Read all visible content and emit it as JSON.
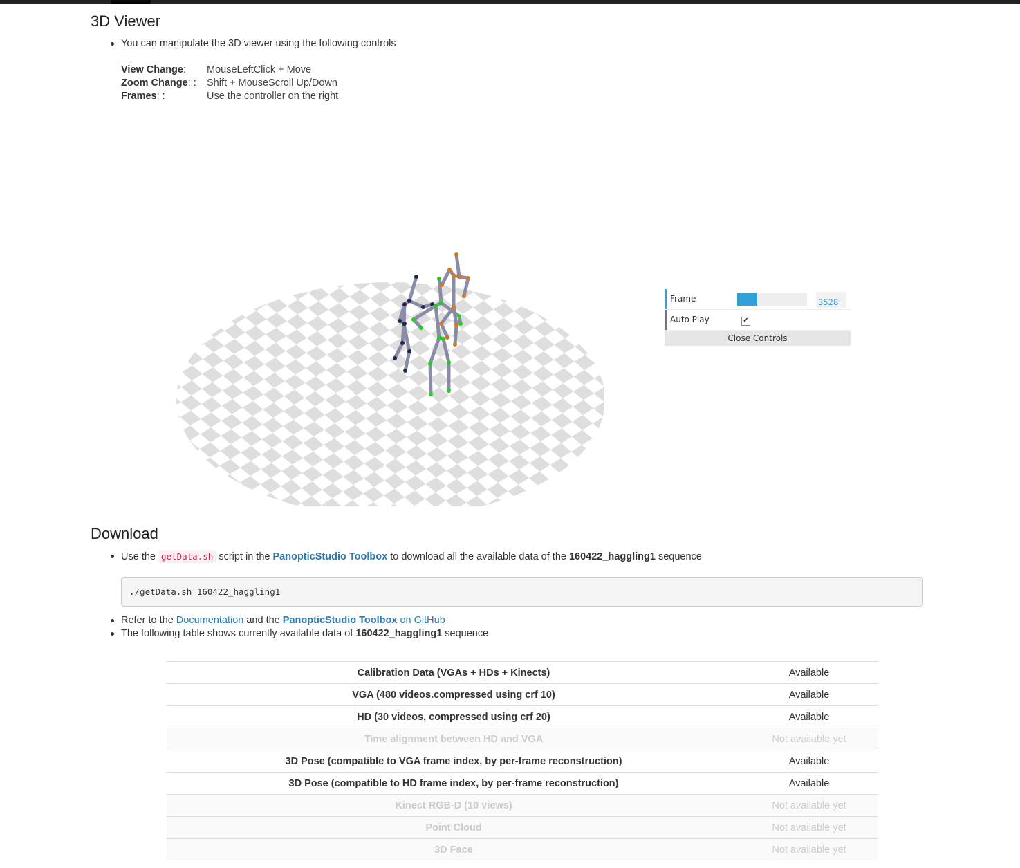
{
  "viewer_section": {
    "title": "3D Viewer",
    "intro": "You can manipulate the 3D viewer using the following controls",
    "controls": [
      {
        "key": "View Change",
        "suffix": ":",
        "value": "MouseLeftClick + Move"
      },
      {
        "key": "Zoom Change",
        "suffix": ": :",
        "value": "Shift + MouseScroll Up/Down"
      },
      {
        "key": "Frames",
        "suffix": ": :",
        "value": "Use the controller on the right"
      }
    ]
  },
  "gui": {
    "frame_label": "Frame",
    "frame_value": "3528",
    "frame_fraction": 0.29,
    "autoplay_label": "Auto Play",
    "autoplay_checked": true,
    "close_label": "Close Controls",
    "colors": {
      "accent": "#2fa1d6",
      "frame_bar": "#2fa1d6",
      "autoplay_bar": "#806787"
    }
  },
  "skeleton_colors": {
    "body": "#8a8ca8",
    "joint_green": "#22cc22",
    "joint_orange": "#d9781a",
    "joint_navy": "#1c2a4a"
  },
  "download": {
    "title": "Download",
    "line1": {
      "pre": "Use the",
      "code": "getData.sh",
      "mid": "script in the",
      "link": "PanopticStudio Toolbox",
      "post": "to download all the available data of the",
      "seq": "160422_haggling1",
      "end": "sequence"
    },
    "command": "./getData.sh 160422_haggling1",
    "line2": {
      "pre": "Refer to the",
      "link_doc": "Documentation",
      "mid": "and the",
      "link_toolbox": "PanopticStudio Toolbox",
      "link_github": "on GitHub"
    },
    "line3": {
      "pre": "The following table shows currently available data of",
      "seq": "160422_haggling1",
      "end": "sequence"
    }
  },
  "table": {
    "rows": [
      {
        "name": "Calibration Data (VGAs + HDs + Kinects)",
        "status": "Available",
        "available": true
      },
      {
        "name": "VGA (480 videos.compressed using crf 10)",
        "status": "Available",
        "available": true
      },
      {
        "name": "HD (30 videos, compressed using crf 20)",
        "status": "Available",
        "available": true
      },
      {
        "name": "Time alignment between HD and VGA",
        "status": "Not available yet",
        "available": false
      },
      {
        "name": "3D Pose (compatible to VGA frame index, by per-frame reconstruction)",
        "status": "Available",
        "available": true
      },
      {
        "name": "3D Pose (compatible to HD frame index, by per-frame reconstruction)",
        "status": "Available",
        "available": true
      },
      {
        "name": "Kinect RGB-D (10 views)",
        "status": "Not available yet",
        "available": false
      },
      {
        "name": "Point Cloud",
        "status": "Not available yet",
        "available": false
      },
      {
        "name": "3D Face",
        "status": "Not available yet",
        "available": false
      }
    ]
  }
}
